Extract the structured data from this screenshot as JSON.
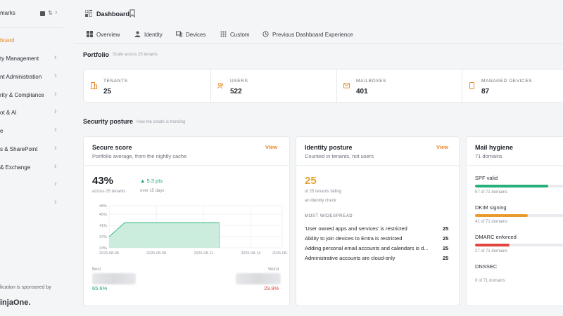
{
  "sidebar": {
    "header": "marks",
    "items": [
      {
        "label": "board",
        "active": true
      },
      {
        "label": "ty Management"
      },
      {
        "label": "nt Administration"
      },
      {
        "label": "rity & Compliance"
      },
      {
        "label": "ot & AI"
      },
      {
        "label": "e"
      },
      {
        "label": "s & SharePoint"
      },
      {
        "label": "& Exchange"
      },
      {
        "label": ""
      },
      {
        "label": ""
      }
    ],
    "sponsor": "lication is sponsored by",
    "logo": "injaOne."
  },
  "topbar": {
    "title": "Dashboard"
  },
  "tabs": [
    "Overview",
    "Identity",
    "Devices",
    "Custom",
    "Previous Dashboard Experience"
  ],
  "portfolio": {
    "title": "Portfolio",
    "subtitle": "Scale across 25 tenants",
    "tiles": [
      {
        "label": "TENANTS",
        "value": "25"
      },
      {
        "label": "USERS",
        "value": "522"
      },
      {
        "label": "MAILBOXES",
        "value": "401"
      },
      {
        "label": "MANAGED DEVICES",
        "value": "87"
      }
    ]
  },
  "security_posture": {
    "title": "Security posture",
    "subtitle": "How the estate is trending"
  },
  "secure_score": {
    "title": "Secure score",
    "subtitle": "Portfolio average, from the nightly cache",
    "view": "View",
    "value": "43%",
    "value_caption": "across 25 tenants",
    "delta": "5.3 pts",
    "delta_caption": "over 15 days",
    "best_label": "Best",
    "best_value": "65.6%",
    "worst_label": "Worst",
    "worst_value": "29.9%"
  },
  "chart_data": {
    "type": "area",
    "x": [
      "2026-08-05",
      "2026-08-06",
      "2026-08-11",
      "2026-08-12"
    ],
    "y": [
      37,
      42,
      42,
      42
    ],
    "x_ticks": [
      "2026-08-05",
      "2026-08-08",
      "2026-08-11",
      "2026-08-14",
      "2026-08-16"
    ],
    "y_ticks": [
      "33%",
      "37%",
      "41%",
      "45%",
      "48%"
    ],
    "ylim": [
      33,
      48
    ],
    "grid": true,
    "color": "#bfe8d6",
    "line_color": "#3cb985"
  },
  "identity_posture": {
    "title": "Identity posture",
    "subtitle": "Counted in tenants, not users",
    "view": "View",
    "value": "25",
    "caption1": "of 25 tenants failing",
    "caption2": "an identity check",
    "widespread_label": "MOST WIDESPREAD",
    "rows": [
      {
        "label": "'User owned apps and services' is restricted",
        "count": "25"
      },
      {
        "label": "Ability to join devices to Entra is restricted",
        "count": "25"
      },
      {
        "label": "Adding personal email accounts and calendars is d...",
        "count": "25"
      },
      {
        "label": "Administrative accounts are cloud-only",
        "count": "25"
      }
    ]
  },
  "mail_hygiene": {
    "title": "Mail hygiene",
    "subtitle": "71 domains",
    "rows": [
      {
        "label": "SPF valid",
        "count": "57 of 71 domains",
        "fraction": 0.803,
        "color": "#27b07a"
      },
      {
        "label": "DKIM signing",
        "count": "41 of 71 domains",
        "fraction": 0.577,
        "color": "#e99a2c"
      },
      {
        "label": "DMARC enforced",
        "count": "27 of 71 domains",
        "fraction": 0.38,
        "color": "#e0453f"
      },
      {
        "label": "DNSSEC",
        "count": "0 of 71 domains",
        "fraction": 0.0,
        "color": "#9aa0a8"
      }
    ]
  }
}
